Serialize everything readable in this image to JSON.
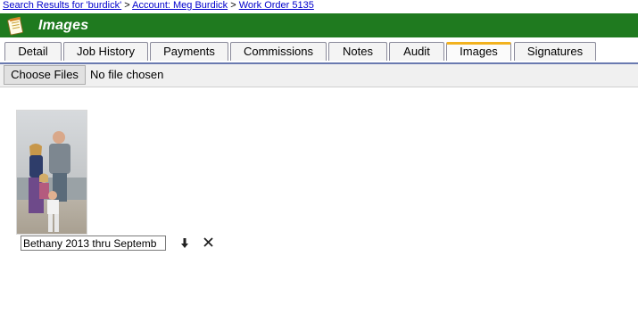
{
  "breadcrumb": {
    "items": [
      {
        "label": "Search Results for 'burdick'"
      },
      {
        "label": "Account: Meg Burdick"
      },
      {
        "label": "Work Order 5135"
      }
    ],
    "separator": " > "
  },
  "header": {
    "title": "Images",
    "icon": "notepad-icon",
    "background": "#1f7a1f"
  },
  "tabs": [
    {
      "label": "Detail"
    },
    {
      "label": "Job History"
    },
    {
      "label": "Payments"
    },
    {
      "label": "Commissions"
    },
    {
      "label": "Notes"
    },
    {
      "label": "Audit"
    },
    {
      "label": "Images",
      "active": true
    },
    {
      "label": "Signatures"
    }
  ],
  "upload": {
    "button_label": "Choose Files",
    "status": "No file chosen"
  },
  "images": [
    {
      "caption": "Bethany 2013 thru Septemb",
      "download_icon": "download-arrow-icon",
      "delete_icon": "close-icon"
    }
  ],
  "colors": {
    "accent_tab": "#f2b21f",
    "link": "#0000cc",
    "tab_underline": "#6a7ab0"
  }
}
